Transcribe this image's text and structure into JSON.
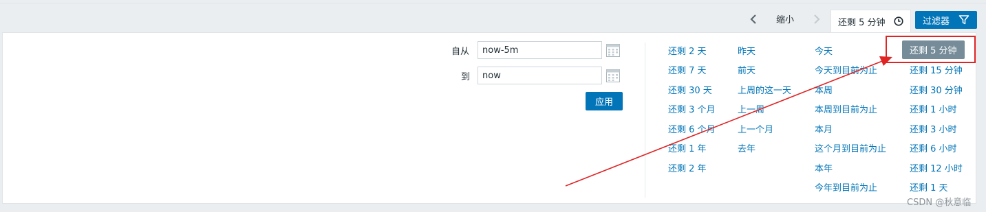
{
  "header": {
    "zoom_out_label": "缩小",
    "range_label": "还剩 5 分钟",
    "filter_label": "过滤器"
  },
  "form": {
    "from_label": "自从",
    "from_value": "now-5m",
    "to_label": "到",
    "to_value": "now",
    "apply_label": "应用"
  },
  "quick_ranges": {
    "col1": [
      "还剩 2 天",
      "还剩 7 天",
      "还剩 30 天",
      "还剩 3 个月",
      "还剩 6 个月",
      "还剩 1 年",
      "还剩 2 年"
    ],
    "col2": [
      "昨天",
      "前天",
      "上周的这一天",
      "上一周",
      "上一个月",
      "去年"
    ],
    "col3": [
      "今天",
      "今天到目前为止",
      "本周",
      "本周到目前为止",
      "本月",
      "这个月到目前为止",
      "本年",
      "今年到目前为止"
    ],
    "col4": [
      "还剩 5 分钟",
      "还剩 15 分钟",
      "还剩 30 分钟",
      "还剩 1 小时",
      "还剩 3 小时",
      "还剩 6 小时",
      "还剩 12 小时",
      "还剩 1 天"
    ],
    "active": "还剩 5 分钟"
  },
  "watermark": "CSDN @秋意临",
  "colors": {
    "accent": "#0275b8",
    "active_bg": "#768d99",
    "highlight": "#e02424"
  },
  "icons": [
    "chevron-left-icon",
    "chevron-right-icon",
    "clock-icon",
    "filter-icon",
    "calendar-icon"
  ]
}
